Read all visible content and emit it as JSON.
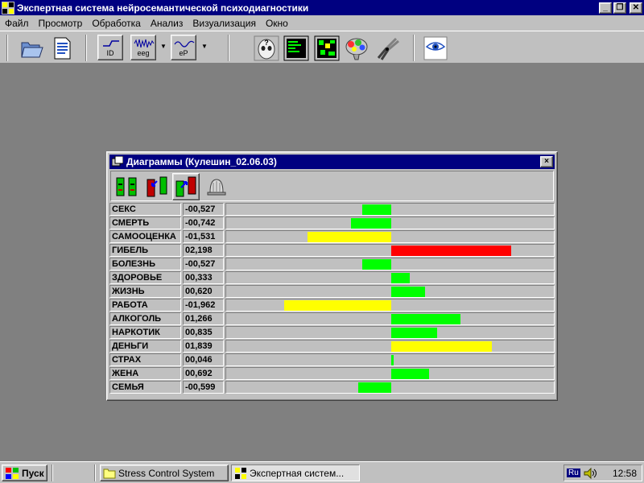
{
  "window": {
    "title": "Экспертная система нейросемантической психодиагностики",
    "controls": [
      "minimize-icon",
      "restore-icon",
      "close-icon"
    ]
  },
  "menu": [
    "Файл",
    "Просмотр",
    "Обработка",
    "Анализ",
    "Визуализация",
    "Окно"
  ],
  "toolbar": {
    "id_label": "ID",
    "eeg_label": "eeg",
    "ep_label": "eP"
  },
  "dialog": {
    "title": "Диаграммы (Кулешин_02.06.03)",
    "close": "×"
  },
  "colors": {
    "positive": "#00ff00",
    "warning": "#ffff00",
    "critical": "#ff0000",
    "titlebar": "#000080"
  },
  "diagram_rows": [
    {
      "name": "СЕКС",
      "value_text": "-00,527",
      "value": -0.527,
      "color": "#00ff00"
    },
    {
      "name": "СМЕРТЬ",
      "value_text": "-00,742",
      "value": -0.742,
      "color": "#00ff00"
    },
    {
      "name": "САМООЦЕНКА",
      "value_text": "-01,531",
      "value": -1.531,
      "color": "#ffff00"
    },
    {
      "name": "ГИБЕЛЬ",
      "value_text": "02,198",
      "value": 2.198,
      "color": "#ff0000"
    },
    {
      "name": "БОЛЕЗНЬ",
      "value_text": "-00,527",
      "value": -0.527,
      "color": "#00ff00"
    },
    {
      "name": "ЗДОРОВЬЕ",
      "value_text": "00,333",
      "value": 0.333,
      "color": "#00ff00"
    },
    {
      "name": "ЖИЗНЬ",
      "value_text": "00,620",
      "value": 0.62,
      "color": "#00ff00"
    },
    {
      "name": "РАБОТА",
      "value_text": "-01,962",
      "value": -1.962,
      "color": "#ffff00"
    },
    {
      "name": "АЛКОГОЛЬ",
      "value_text": "01,266",
      "value": 1.266,
      "color": "#00ff00"
    },
    {
      "name": "НАРКОТИК",
      "value_text": "00,835",
      "value": 0.835,
      "color": "#00ff00"
    },
    {
      "name": "ДЕНЬГИ",
      "value_text": "01,839",
      "value": 1.839,
      "color": "#ffff00"
    },
    {
      "name": "СТРАХ",
      "value_text": "00,046",
      "value": 0.046,
      "color": "#00ff00"
    },
    {
      "name": "ЖЕНА",
      "value_text": "00,692",
      "value": 0.692,
      "color": "#00ff00"
    },
    {
      "name": "СЕМЬЯ",
      "value_text": "-00,599",
      "value": -0.599,
      "color": "#00ff00"
    }
  ],
  "taskbar": {
    "start_label": "Пуск",
    "tasks": [
      "Stress Control System",
      "Экспертная систем..."
    ],
    "tray_lang": "Ru",
    "clock": "12:58"
  }
}
